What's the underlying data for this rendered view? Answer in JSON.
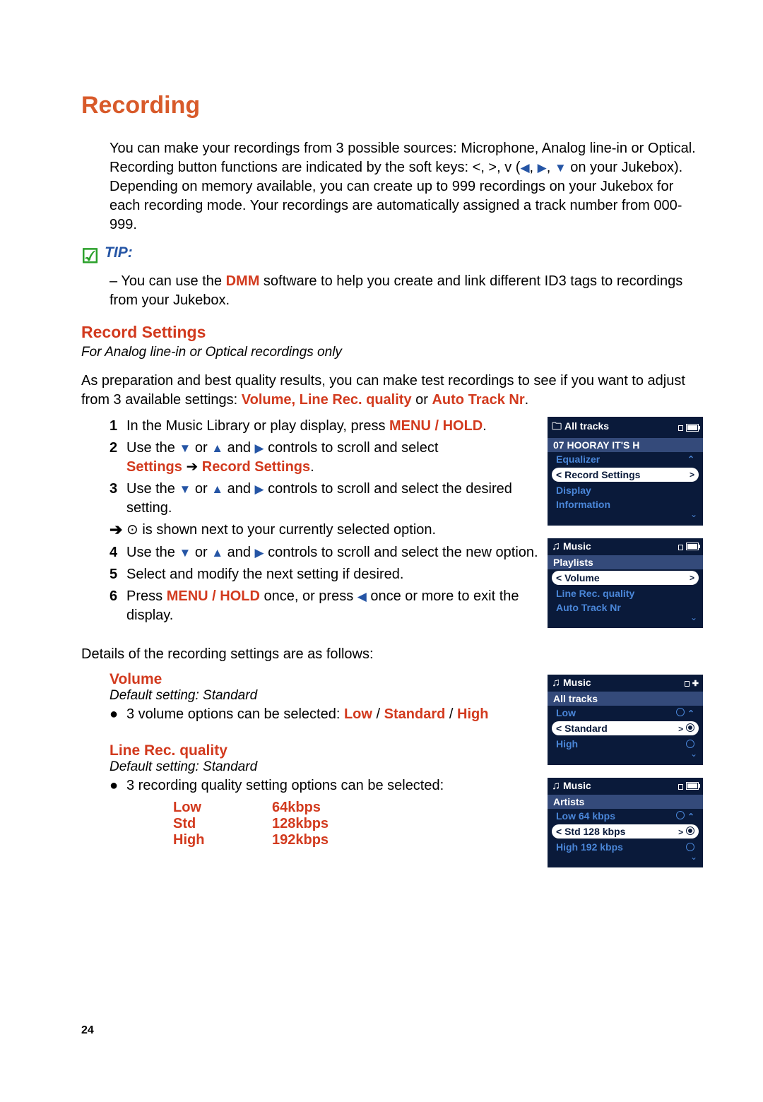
{
  "title": "Recording",
  "intro_p1a": "You can make your recordings from 3 possible sources: Microphone, Analog line-in or Optical. Recording button functions are indicated by the soft keys: <, >, v (",
  "intro_p1b": " on your Jukebox).",
  "intro_p2": "Depending on memory available, you can create up to 999 recordings on your Jukebox for each recording mode. Your recordings are automatically assigned a track number from 000-999.",
  "tip_label": "TIP:",
  "tip_body_a": "– You can use the ",
  "tip_dmm": "DMM",
  "tip_body_b": " software to help you create and link different ID3 tags to recordings from your Jukebox.",
  "record_settings_head": "Record Settings",
  "record_settings_note": "For Analog line-in or Optical recordings only",
  "record_intro_a": "As preparation and best quality results, you can make test recordings to see if you want to adjust from 3 available settings: ",
  "record_intro_b": "Volume, Line Rec. quality",
  "record_intro_c": " or ",
  "record_intro_d": "Auto Track Nr",
  "record_intro_e": ".",
  "steps": [
    {
      "num": "1",
      "a": "In the Music Library or play display, press ",
      "red": "MENU / HOLD",
      "b": "."
    },
    {
      "num": "2",
      "a": "Use the ",
      "b": " or ",
      "c": " and ",
      "d": " controls to scroll and select",
      "line2_a": "Settings",
      "line2_arrow": " ➔ ",
      "line2_b": "Record Settings",
      "line2_c": "."
    },
    {
      "num": "3",
      "a": "Use the ",
      "b": " or ",
      "c": " and ",
      "d": " controls to scroll and select the desired setting."
    }
  ],
  "arrow_text": " is shown next to your currently selected option.",
  "step4": {
    "num": "4",
    "a": "Use the ",
    "b": " or ",
    "c": " and ",
    "d": " controls to scroll and select the new option."
  },
  "step5": {
    "num": "5",
    "text": "Select and modify the next setting if desired."
  },
  "step6": {
    "num": "6",
    "a": "Press ",
    "red": "MENU / HOLD",
    "b": " once, or press ",
    "c": " once or more to exit the display."
  },
  "details_line": "Details of the recording settings are as follows:",
  "volume_head": "Volume",
  "volume_default": "Default setting: Standard",
  "volume_bullet_a": "3 volume options can be selected: ",
  "volume_opts": {
    "low": "Low",
    "sep1": " / ",
    "std": "Standard",
    "sep2": " / ",
    "high": "High"
  },
  "linerec_head": "Line Rec. quality",
  "linerec_default": "Default setting: Standard",
  "linerec_bullet": "3 recording quality setting options can be selected:",
  "quality_rows": [
    {
      "label": "Low",
      "val": "64kbps"
    },
    {
      "label": "Std",
      "val": "128kbps"
    },
    {
      "label": "High",
      "val": "192kbps"
    }
  ],
  "page_number": "24",
  "device1": {
    "header": "All tracks",
    "nowplaying": "07 HOORAY IT'S H",
    "items": [
      {
        "label": "Equalizer",
        "selected": false
      },
      {
        "label": "Record Settings",
        "selected": true,
        "arrow_left": true,
        "arrow_right": true
      },
      {
        "label": "Display",
        "selected": false
      },
      {
        "label": "Information",
        "selected": false
      }
    ]
  },
  "device2": {
    "header": "Music",
    "sub": "Playlists",
    "items": [
      {
        "label": "Volume",
        "selected": true,
        "arrow_left": true,
        "arrow_right": true
      },
      {
        "label": "Line Rec. quality",
        "selected": false
      },
      {
        "label": "Auto Track Nr",
        "selected": false
      }
    ]
  },
  "device3": {
    "header": "Music",
    "sub": "All tracks",
    "items": [
      {
        "label": "Low",
        "selected": false,
        "radio": true
      },
      {
        "label": "Standard",
        "selected": true,
        "arrow_left": true,
        "arrow_right": true,
        "radio": true,
        "radio_on": true
      },
      {
        "label": "High",
        "selected": false,
        "radio": true
      }
    ]
  },
  "device4": {
    "header": "Music",
    "sub": "Artists",
    "items": [
      {
        "label": "Low 64 kbps",
        "selected": false,
        "radio": true
      },
      {
        "label": "Std 128 kbps",
        "selected": true,
        "arrow_left": true,
        "arrow_right": true,
        "radio": true,
        "radio_on": true
      },
      {
        "label": "High 192 kbps",
        "selected": false,
        "radio": true
      }
    ]
  }
}
